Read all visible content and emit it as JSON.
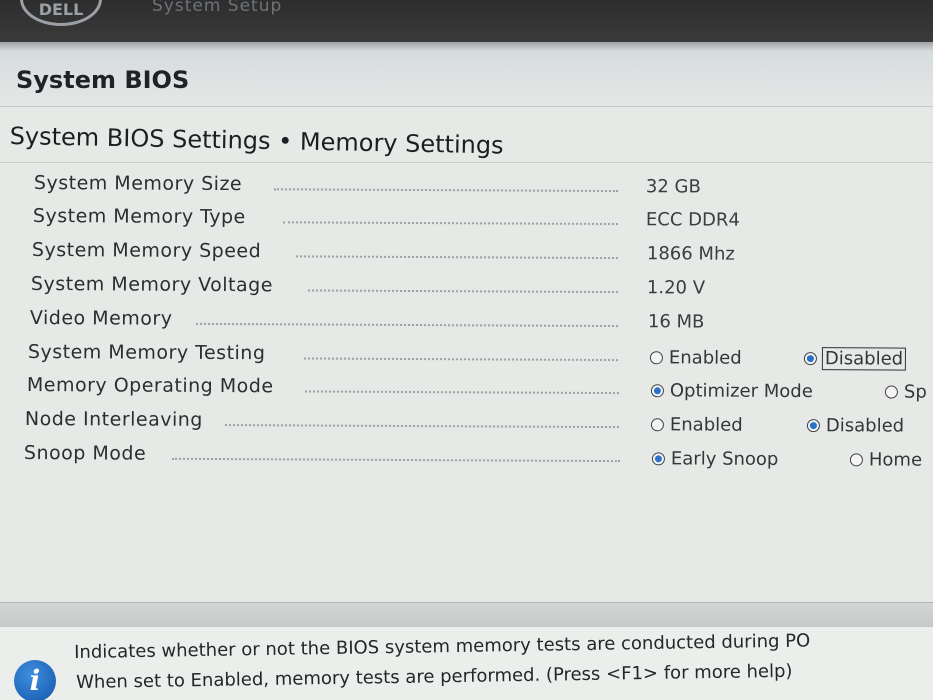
{
  "header": {
    "logo_text": "DELL",
    "app_title": "System Setup"
  },
  "section": {
    "title": "System BIOS"
  },
  "page": {
    "title": "System BIOS Settings • Memory Settings"
  },
  "settings": [
    {
      "label": "System Memory Size",
      "value": "32 GB"
    },
    {
      "label": "System Memory Type",
      "value": "ECC DDR4"
    },
    {
      "label": "System Memory Speed",
      "value": "1866 Mhz"
    },
    {
      "label": "System Memory Voltage",
      "value": "1.20 V"
    },
    {
      "label": "Video Memory",
      "value": "16 MB"
    },
    {
      "label": "System Memory Testing",
      "options": [
        {
          "label": "Enabled",
          "selected": false
        },
        {
          "label": "Disabled",
          "selected": true,
          "focused": true
        }
      ]
    },
    {
      "label": "Memory Operating Mode",
      "options": [
        {
          "label": "Optimizer Mode",
          "selected": true
        },
        {
          "label": "Sp",
          "selected": false
        }
      ]
    },
    {
      "label": "Node Interleaving",
      "options": [
        {
          "label": "Enabled",
          "selected": false
        },
        {
          "label": "Disabled",
          "selected": true
        }
      ]
    },
    {
      "label": "Snoop Mode",
      "options": [
        {
          "label": "Early Snoop",
          "selected": true
        },
        {
          "label": "Home",
          "selected": false
        }
      ]
    }
  ],
  "help": {
    "icon": "info-icon",
    "line1": "Indicates whether or not the BIOS system memory tests are conducted during PO",
    "line2": "When set to Enabled, memory tests are performed. (Press <F1> for more help)"
  },
  "colors": {
    "accent": "#2a72c8",
    "background": "#e7e9e6",
    "topbar": "#2d2d2d"
  }
}
